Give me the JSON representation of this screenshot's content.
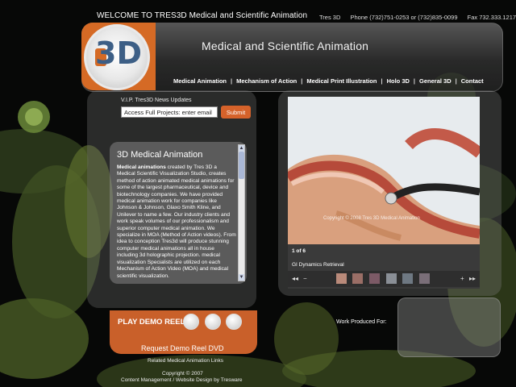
{
  "top": {
    "welcome": "WELCOME TO TRES3D Medical and Scientific Animation",
    "company": "Tres 3D",
    "phone": "Phone (732)751-0253 or (732)835-0099",
    "fax": "Fax 732.333.1217"
  },
  "header": {
    "logo_text": "3D",
    "title": "Medical and Scientific Animation"
  },
  "nav": {
    "items": [
      "Medical Animation",
      "Mechanism of Action",
      "Medical Print Illustration",
      "Holo 3D",
      "General 3D",
      "Contact"
    ],
    "separator": "|"
  },
  "vip": {
    "label": "V.I.P. Tres3D News Updates",
    "input_value": "Access Full Projects: enter email",
    "submit_label": "Submit"
  },
  "article": {
    "title": "3D Medical Animation",
    "lead": "Medical animations",
    "body": " created by Tres 3D a Medical Scientific Visualization Studio, creates method of action animated medical animations for some of the largest pharmaceutical, device and biotechnology companies. We have provided medical animation work for companies like Johnson & Johnson, Glaxo Smith Kline, and Unilever to name a few. Our industry clients and work speak volumes of our professionalism and superior computer medical animation. We specialize in MOA (Method of Action videos). From idea to conception Tres3d will produce stunning computer medical animations all in house including 3d holographic projection. medical visualization Specialists are utilized on each Mechanism of Action Video (MOA) and medical scientific visualization."
  },
  "scroll": {
    "up": "▲",
    "down": "▼"
  },
  "demo": {
    "label": "PLAY DEMO REEL",
    "dvd_label": "Request Demo Reel DVD",
    "related": "Related Medical Animation Links"
  },
  "footer": {
    "copyright": "Copyright © 2007",
    "credit": "Content Management / Website Design by Tresware"
  },
  "viewer": {
    "watermark": "Copyright © 2008 Tres 3D Medical Animation",
    "counter": "1 of 6",
    "caption": "GI Dynamics Retrieval",
    "prev": "◂◂",
    "minus": "−",
    "plus": "+",
    "next": "▸▸"
  },
  "work": {
    "label": "Work Produced For:"
  },
  "colors": {
    "accent_orange": "#c9602a",
    "logo_blue": "#3d5f86"
  }
}
